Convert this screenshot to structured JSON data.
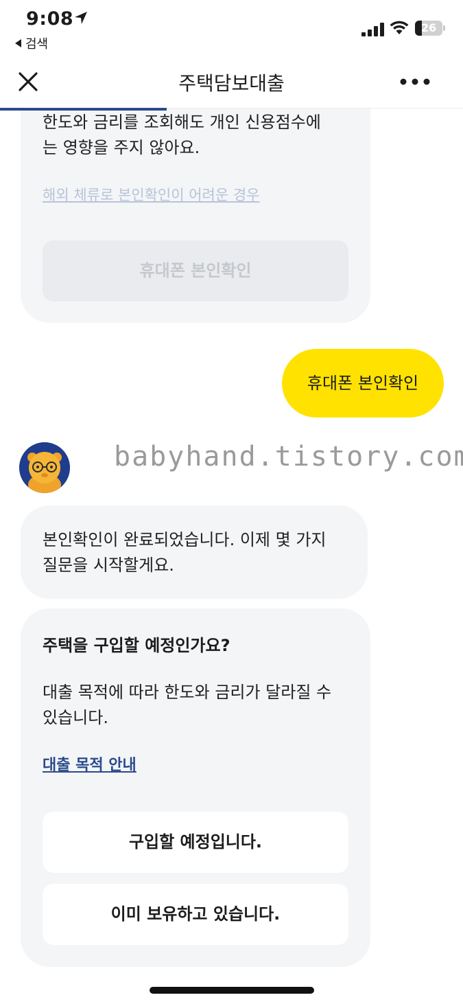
{
  "status_bar": {
    "time": "9:08",
    "back_app": "검색",
    "battery_level": "26",
    "battery_fraction": 0.26
  },
  "nav": {
    "title": "주택담보대출",
    "progress_fraction": 0.36
  },
  "intro_card": {
    "text": "한도와 금리를 조회해도 개인 신용점수에\n는 영향을 주지 않아요.",
    "overseas_link": "해외 체류로 본인확인이 어려운 경우",
    "verify_button": "휴대폰 본인확인"
  },
  "user_reply": "휴대폰 본인확인",
  "watermark": "babyhand.tistory.com",
  "bot_message": "본인확인이 완료되었습니다. 이제 몇 가지\n질문을 시작할게요.",
  "question_card": {
    "title": "주택을 구입할 예정인가요?",
    "description": "대출 목적에 따라 한도와 금리가 달라질 수\n있습니다.",
    "purpose_link": "대출 목적 안내",
    "options": [
      "구입할 예정입니다.",
      "이미 보유하고 있습니다."
    ]
  },
  "colors": {
    "accent_yellow": "#ffe200",
    "accent_blue": "#2b4a8c",
    "card_bg": "#f3f5f7"
  }
}
